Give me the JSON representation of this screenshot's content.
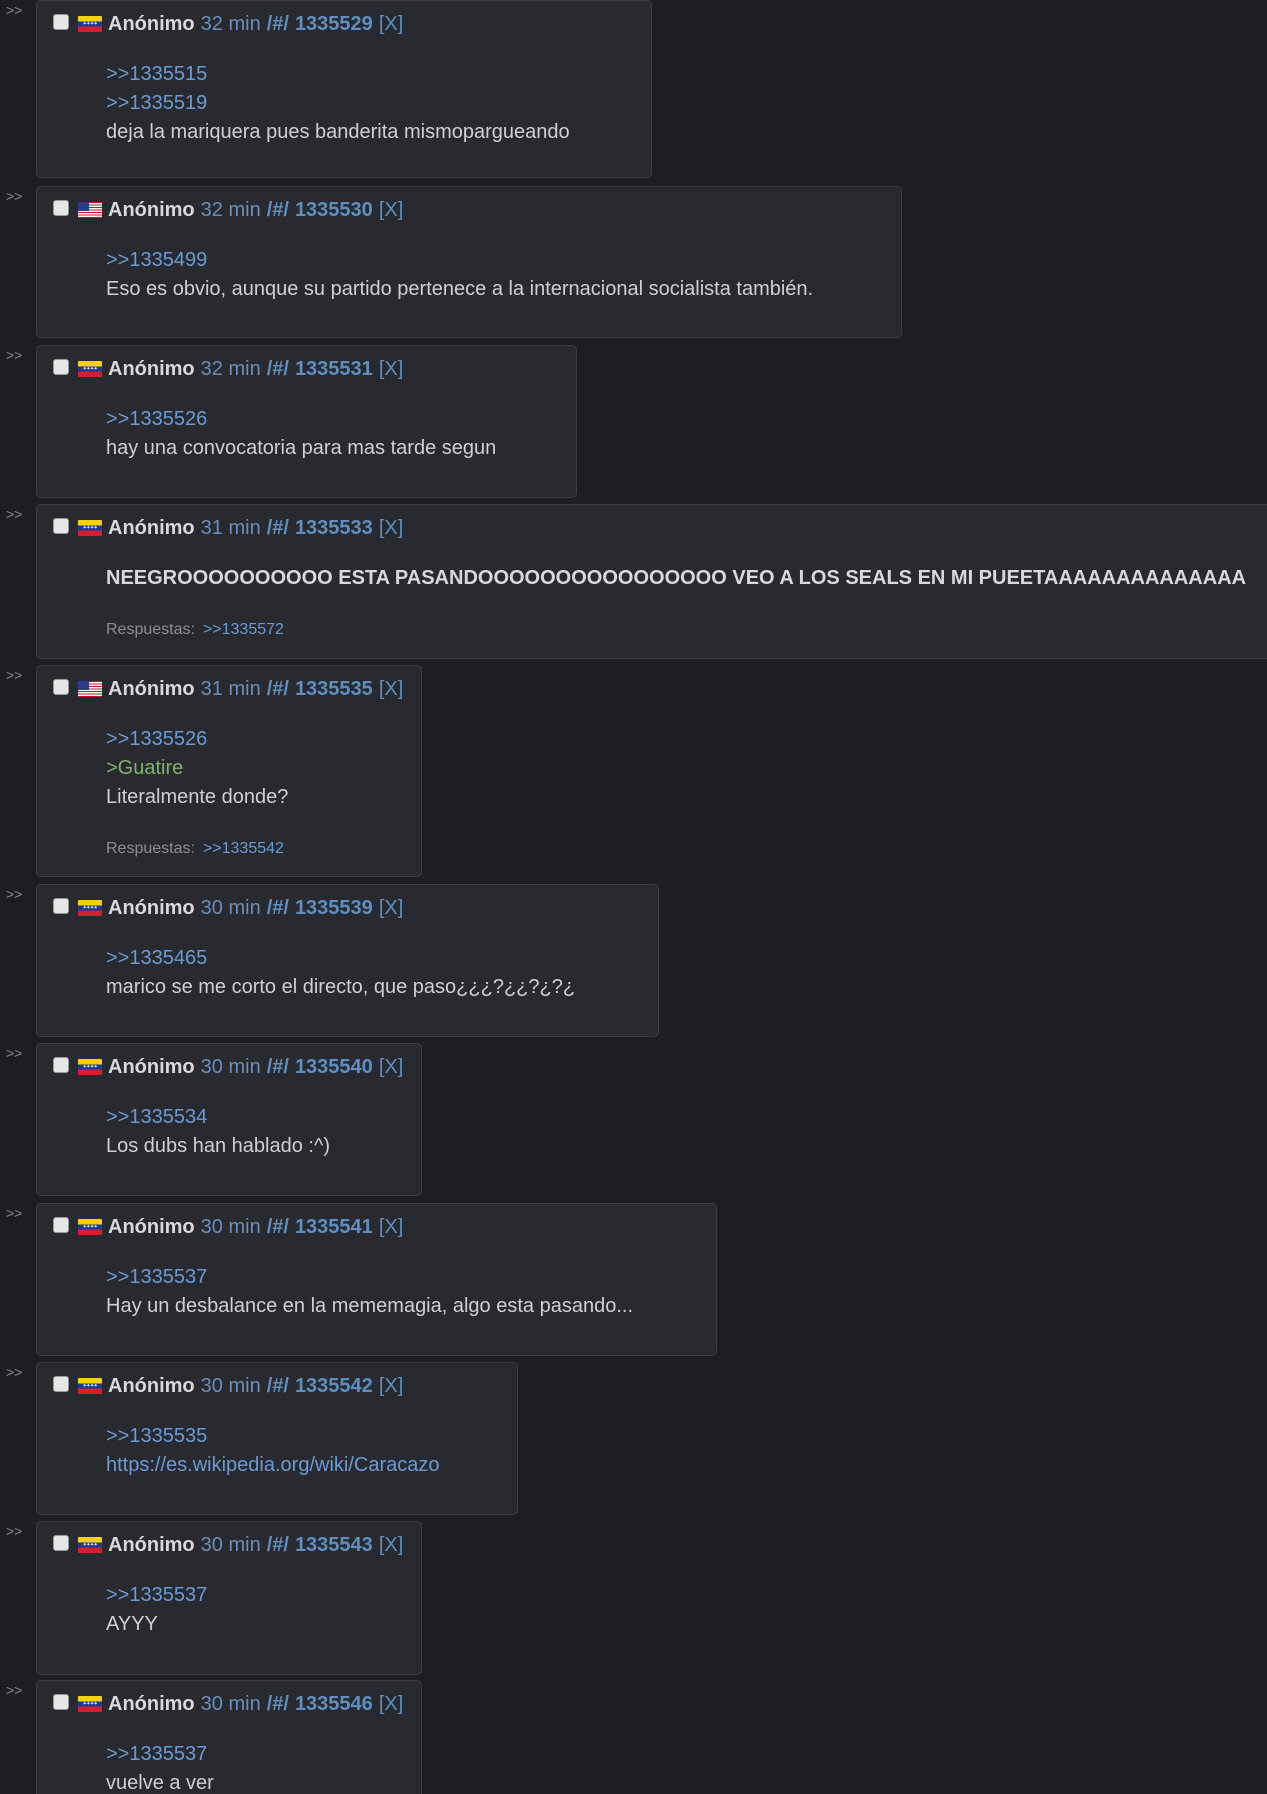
{
  "thread": {
    "posts": [
      {
        "author": "Anónimo",
        "time": "32 min",
        "board": "/#/",
        "id": "1335529",
        "delete": "[X]",
        "flag": "ve",
        "lines": [
          {
            "kind": "quote",
            "text": ">>1335515"
          },
          {
            "kind": "quote",
            "text": ">>1335519"
          },
          {
            "kind": "text",
            "text": "deja la mariquera pues banderita mismopargueando"
          }
        ]
      },
      {
        "author": "Anónimo",
        "time": "32 min",
        "board": "/#/",
        "id": "1335530",
        "delete": "[X]",
        "flag": "us",
        "lines": [
          {
            "kind": "quote",
            "text": ">>1335499"
          },
          {
            "kind": "text",
            "text": "Eso es obvio, aunque su partido pertenece a la internacional socialista también."
          }
        ]
      },
      {
        "author": "Anónimo",
        "time": "32 min",
        "board": "/#/",
        "id": "1335531",
        "delete": "[X]",
        "flag": "ve",
        "lines": [
          {
            "kind": "quote",
            "text": ">>1335526"
          },
          {
            "kind": "text",
            "text": "hay una convocatoria para mas tarde segun"
          }
        ]
      },
      {
        "author": "Anónimo",
        "time": "31 min",
        "board": "/#/",
        "id": "1335533",
        "delete": "[X]",
        "flag": "ve",
        "lines": [
          {
            "kind": "bold",
            "text": "NEEGROOOOOOOOOO ESTA PASANDOOOOOOOOOOOOOOOO VEO A LOS SEALS EN MI PUEETAAAAAAAAAAAAAA"
          }
        ],
        "responses_label": "Respuestas:",
        "responses": ">>1335572"
      },
      {
        "author": "Anónimo",
        "time": "31 min",
        "board": "/#/",
        "id": "1335535",
        "delete": "[X]",
        "flag": "us",
        "lines": [
          {
            "kind": "quote",
            "text": ">>1335526"
          },
          {
            "kind": "green",
            "text": ">Guatire"
          },
          {
            "kind": "text",
            "text": "Literalmente donde?"
          }
        ],
        "responses_label": "Respuestas:",
        "responses": ">>1335542"
      },
      {
        "author": "Anónimo",
        "time": "30 min",
        "board": "/#/",
        "id": "1335539",
        "delete": "[X]",
        "flag": "ve",
        "lines": [
          {
            "kind": "quote",
            "text": ">>1335465"
          },
          {
            "kind": "text",
            "text": "marico se me corto el directo, que paso¿¿¿?¿¿?¿?¿"
          }
        ]
      },
      {
        "author": "Anónimo",
        "time": "30 min",
        "board": "/#/",
        "id": "1335540",
        "delete": "[X]",
        "flag": "ve",
        "lines": [
          {
            "kind": "quote",
            "text": ">>1335534"
          },
          {
            "kind": "text",
            "text": "Los dubs han hablado :^)"
          }
        ]
      },
      {
        "author": "Anónimo",
        "time": "30 min",
        "board": "/#/",
        "id": "1335541",
        "delete": "[X]",
        "flag": "ve",
        "lines": [
          {
            "kind": "quote",
            "text": ">>1335537"
          },
          {
            "kind": "text",
            "text": "Hay un desbalance en la mememagia, algo esta pasando..."
          }
        ]
      },
      {
        "author": "Anónimo",
        "time": "30 min",
        "board": "/#/",
        "id": "1335542",
        "delete": "[X]",
        "flag": "ve",
        "lines": [
          {
            "kind": "quote",
            "text": ">>1335535"
          },
          {
            "kind": "link",
            "text": "https://es.wikipedia.org/wiki/Caracazo"
          }
        ]
      },
      {
        "author": "Anónimo",
        "time": "30 min",
        "board": "/#/",
        "id": "1335543",
        "delete": "[X]",
        "flag": "ve",
        "lines": [
          {
            "kind": "quote",
            "text": ">>1335537"
          },
          {
            "kind": "text",
            "text": "AYYY"
          }
        ]
      },
      {
        "author": "Anónimo",
        "time": "30 min",
        "board": "/#/",
        "id": "1335546",
        "delete": "[X]",
        "flag": "ve",
        "lines": [
          {
            "kind": "quote",
            "text": ">>1335537"
          },
          {
            "kind": "text",
            "text": "vuelve a ver"
          }
        ]
      }
    ]
  },
  "ui": {
    "side_arrow": ">>"
  }
}
